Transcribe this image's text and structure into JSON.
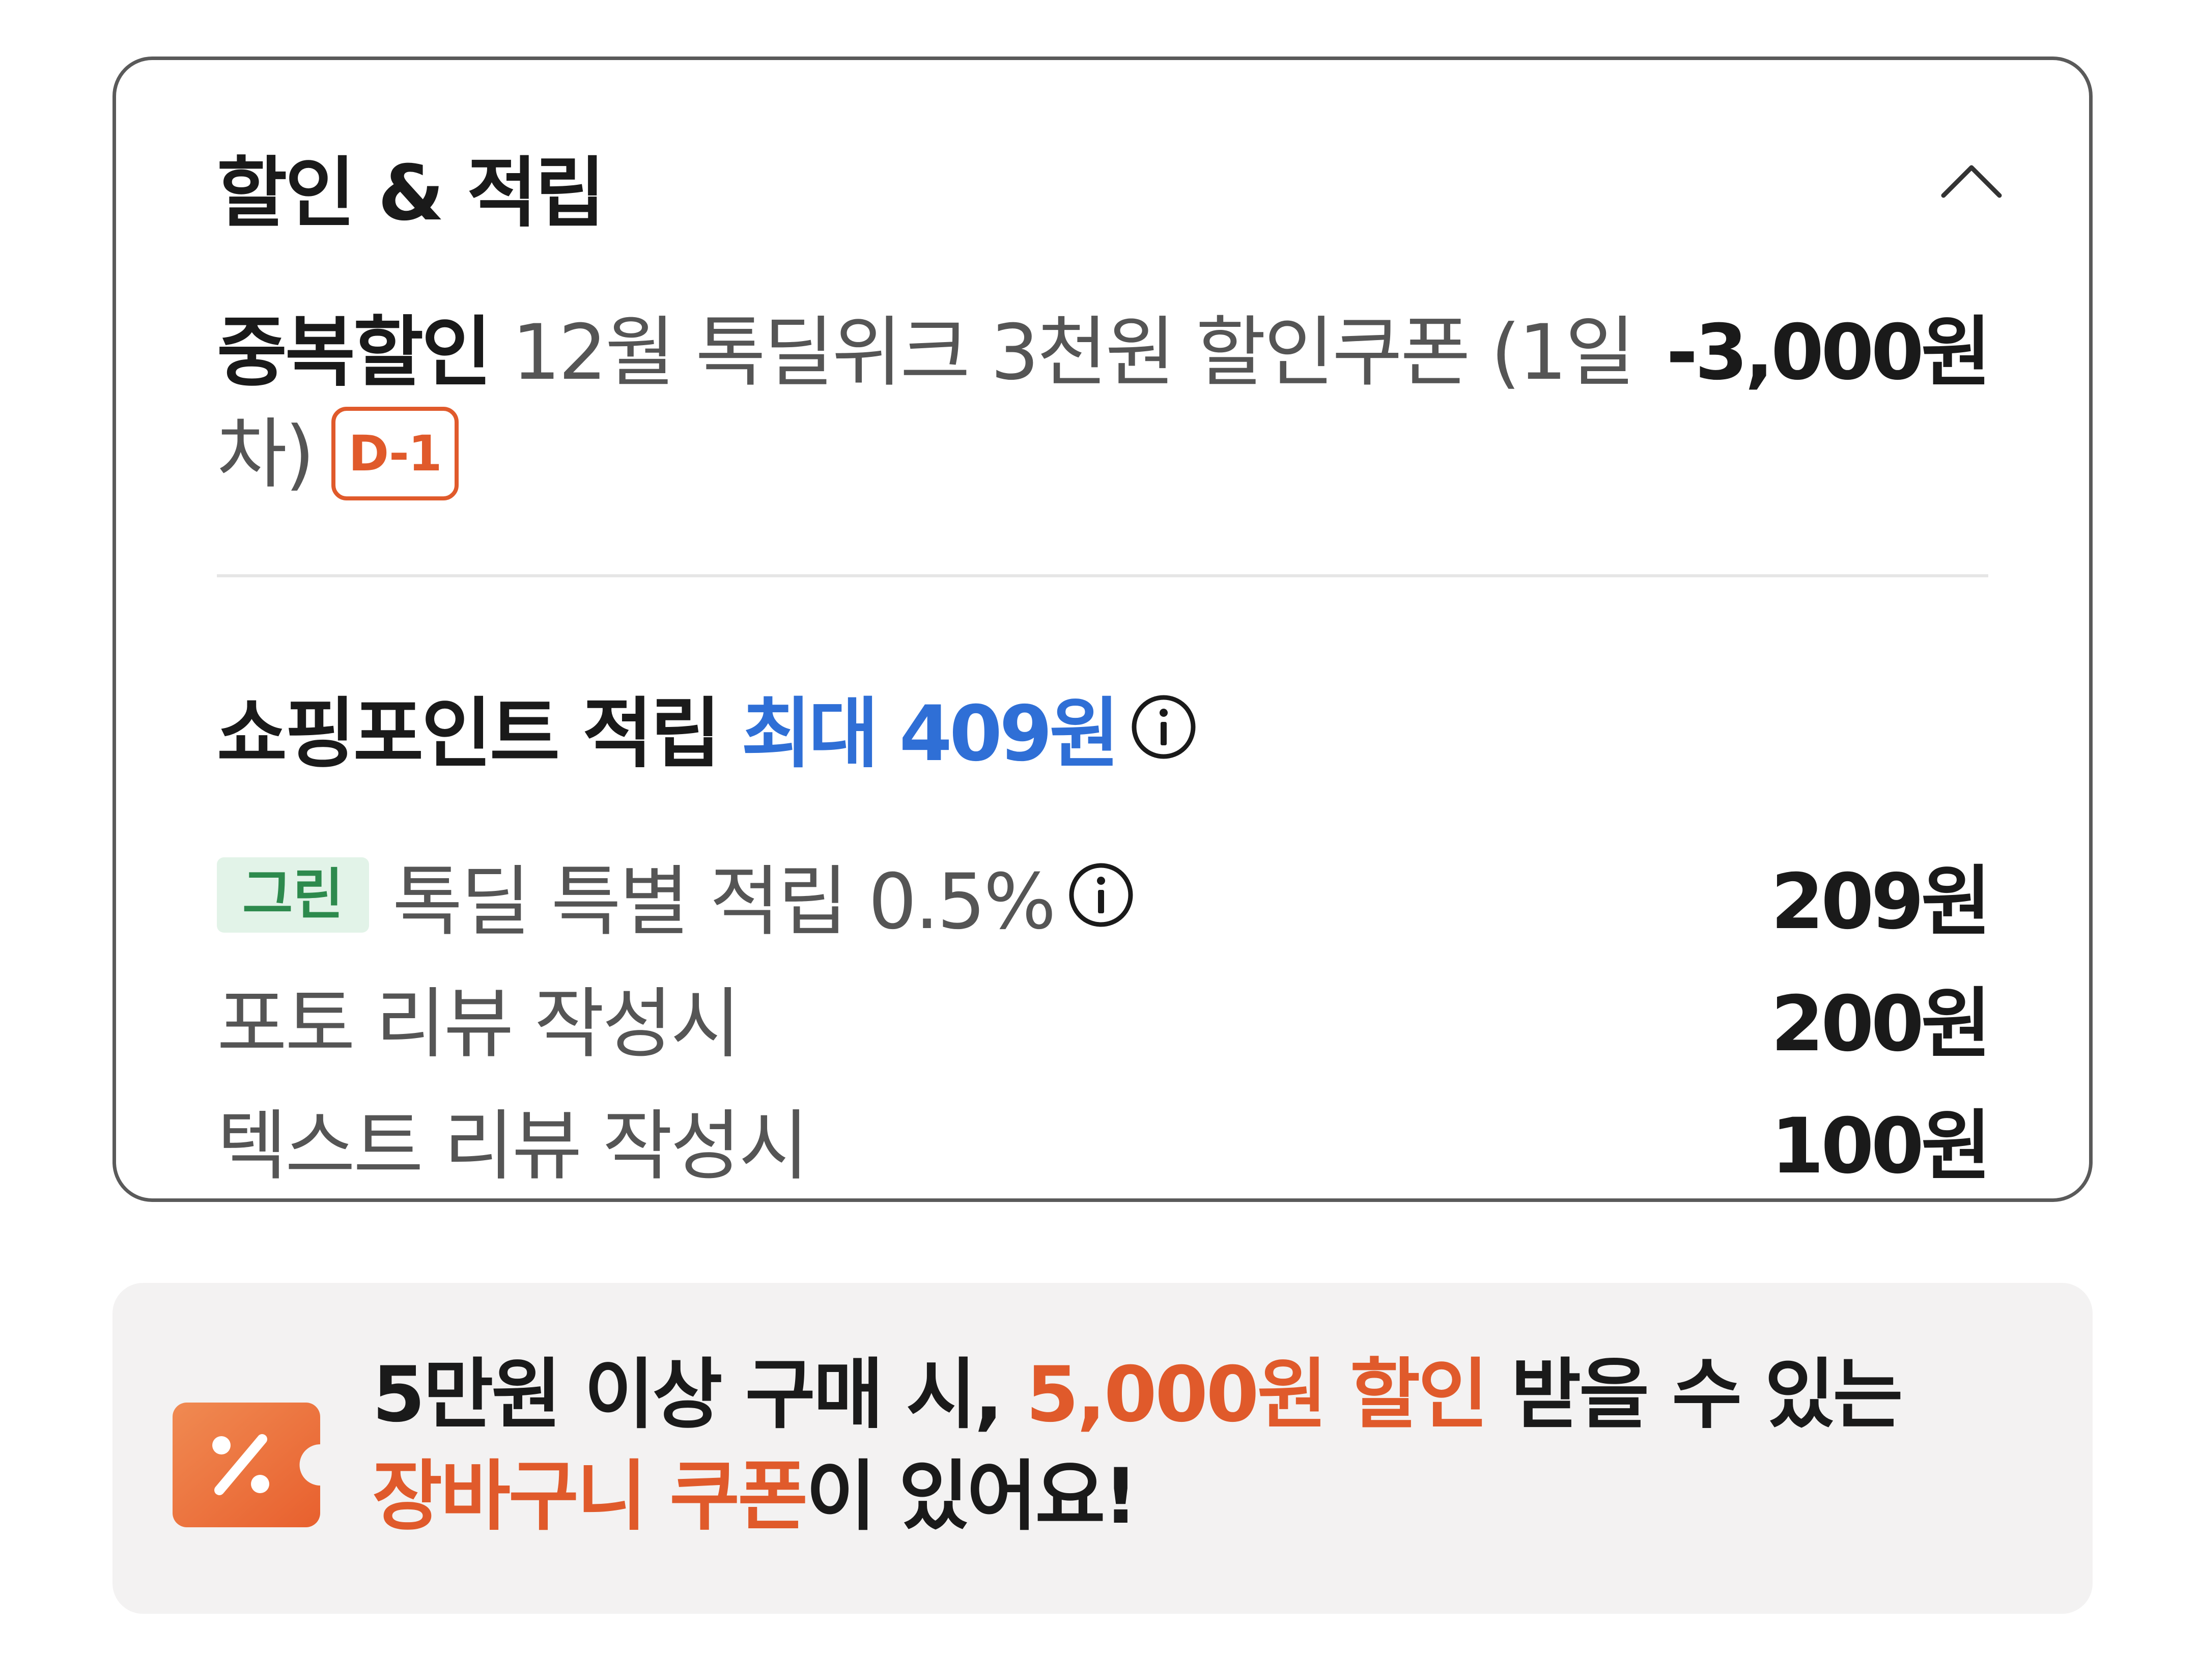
{
  "section": {
    "title": "할인 & 적립",
    "collapse_icon": "chevron-up-icon"
  },
  "discount": {
    "label": "중복할인",
    "description": "12월 톡딜위크 3천원 할인쿠폰 (1일차)",
    "badge": "D-1",
    "amount": "-3,000원"
  },
  "points": {
    "title": "쇼핑포인트 적립",
    "max_text": "최대 409원",
    "info_icon": "info-icon",
    "rows": [
      {
        "badge": "그린",
        "label": "톡딜 특별 적립 0.5%",
        "amount": "209원",
        "has_info": true
      },
      {
        "label": "포토 리뷰 작성시",
        "amount": "200원"
      },
      {
        "label": "텍스트 리뷰 작성시",
        "amount": "100원"
      }
    ]
  },
  "banner": {
    "icon": "coupon-percent-icon",
    "text_before": "5만원 이상 구매 시, ",
    "highlight_1": "5,000원 할인",
    "text_middle": " 받을 수 있는 ",
    "highlight_2": "장바구니 쿠폰",
    "text_after": "이 있어요!"
  },
  "colors": {
    "accent_orange": "#e05a2b",
    "accent_blue": "#2f6fd6",
    "badge_green_bg": "#e2f3e8",
    "badge_green_text": "#2d8a4d",
    "banner_bg": "#f3f2f2"
  }
}
